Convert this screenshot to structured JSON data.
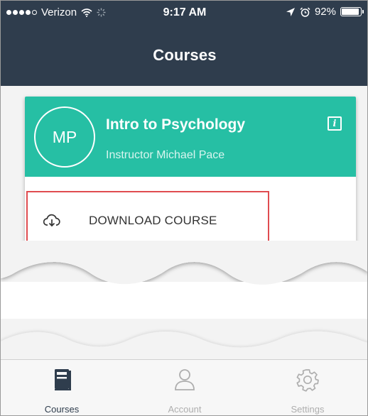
{
  "status_bar": {
    "carrier": "Verizon",
    "time": "9:17 AM",
    "battery": "92%",
    "battery_level": 0.92,
    "icons": [
      "signal-dots-icon",
      "wifi-icon",
      "activity-icon",
      "location-icon",
      "alarm-icon",
      "battery-icon"
    ]
  },
  "nav": {
    "title": "Courses"
  },
  "course_card": {
    "avatar_initials": "MP",
    "title": "Intro to Psychology",
    "instructor": "Instructor Michael Pace",
    "info_icon": "i",
    "download_label": "DOWNLOAD COURSE",
    "download_icon": "cloud-download-icon"
  },
  "tabbar": {
    "tabs": [
      {
        "label": "Courses",
        "icon": "book-icon",
        "active": true
      },
      {
        "label": "Account",
        "icon": "person-icon",
        "active": false
      },
      {
        "label": "Settings",
        "icon": "gear-icon",
        "active": false
      }
    ]
  },
  "colors": {
    "header_bg": "#2f3d4d",
    "card_accent": "#26bfa4",
    "highlight_border": "#e04c50",
    "tab_active": "#2f3d4d",
    "tab_inactive": "#aeaeae"
  }
}
